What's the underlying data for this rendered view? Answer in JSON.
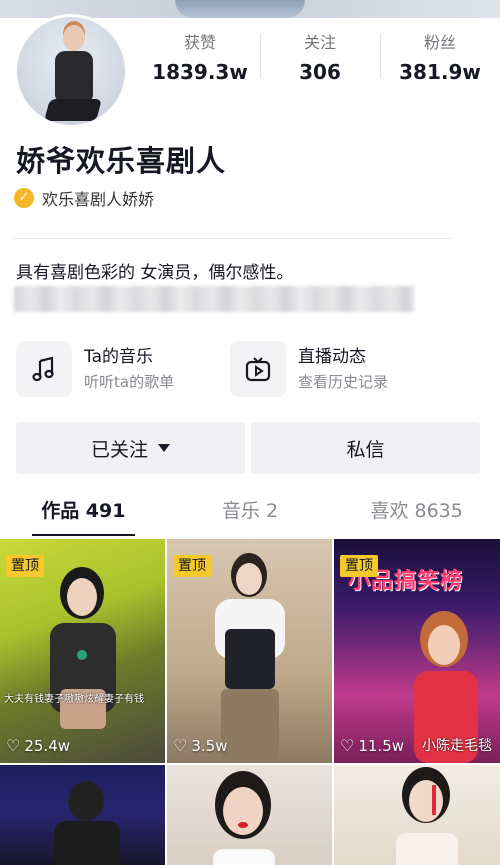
{
  "profile": {
    "name": "娇爷欢乐喜剧人",
    "verified_label": "欢乐喜剧人娇娇",
    "bio": "具有喜剧色彩的 女演员，偶尔感性。",
    "verify_glyph": "✓"
  },
  "stats": [
    {
      "label": "获赞",
      "value": "1839.3w"
    },
    {
      "label": "关注",
      "value": "306"
    },
    {
      "label": "粉丝",
      "value": "381.9w"
    }
  ],
  "features": [
    {
      "title": "Ta的音乐",
      "subtitle": "听听ta的歌单",
      "icon": "music-note-icon"
    },
    {
      "title": "直播动态",
      "subtitle": "查看历史记录",
      "icon": "tv-icon"
    }
  ],
  "buttons": {
    "follow_label": "已关注",
    "message_label": "私信"
  },
  "tabs": [
    {
      "label": "作品 491",
      "active": true
    },
    {
      "label": "音乐 2",
      "active": false
    },
    {
      "label": "喜欢 8635",
      "active": false
    }
  ],
  "videos": [
    {
      "pinned": "置顶",
      "likes": "25.4w",
      "caption": "大夫有钱妻子嗷嗷炫耀妻子有钱"
    },
    {
      "pinned": "置顶",
      "likes": "3.5w",
      "caption": ""
    },
    {
      "pinned": "置顶",
      "likes": "11.5w",
      "caption": "",
      "banner": "小品搞笑榜",
      "overlay": "小陈走毛毯"
    },
    {
      "pinned": "",
      "likes": "",
      "caption": ""
    },
    {
      "pinned": "",
      "likes": "",
      "caption": ""
    },
    {
      "pinned": "",
      "likes": "",
      "caption": ""
    }
  ],
  "colors": {
    "accent_pin": "#f6c82c",
    "verify_badge": "#f5b625",
    "text_primary": "#161823",
    "text_secondary": "#8a8b91"
  }
}
